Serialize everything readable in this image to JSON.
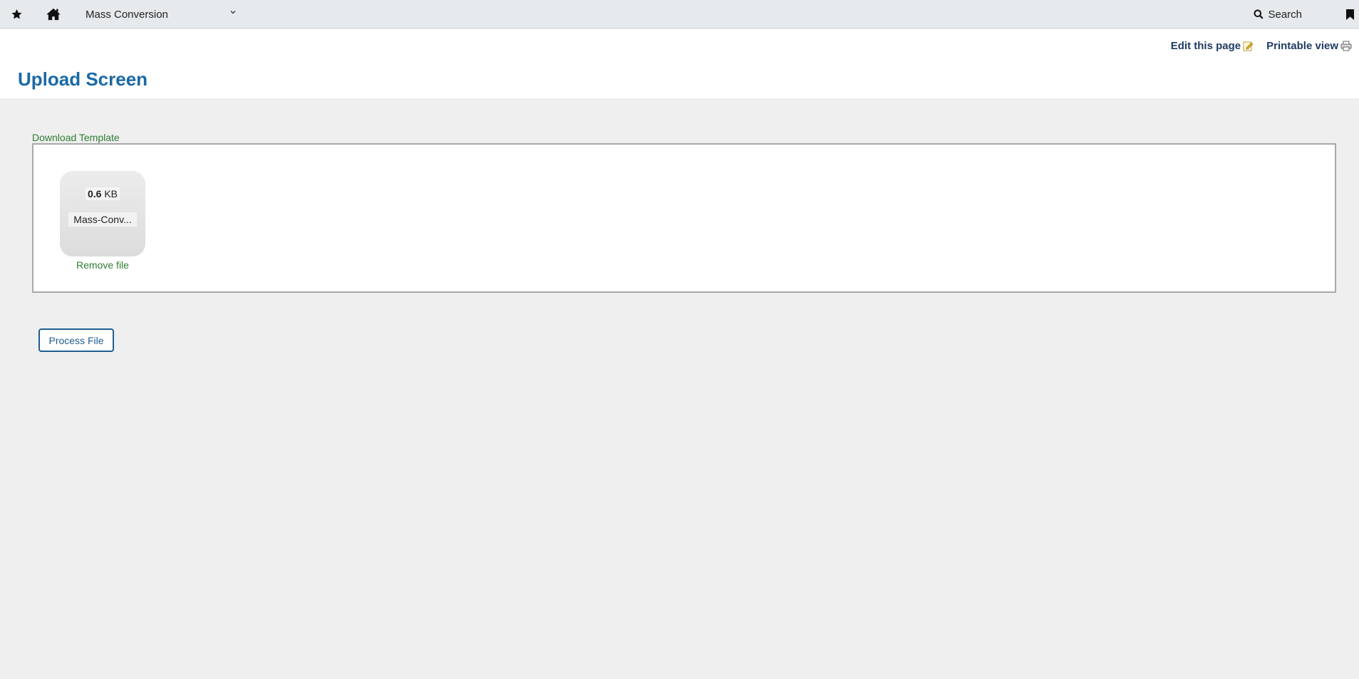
{
  "topbar": {
    "module_label": "Mass Conversion",
    "search_label": "Search",
    "icons": [
      "star-icon",
      "home-icon",
      "chevron-down-icon",
      "search-icon",
      "bookmark-icon"
    ]
  },
  "header": {
    "edit_label": "Edit this page",
    "printable_label": "Printable view",
    "title": "Upload Screen"
  },
  "upload": {
    "download_label": "Download Template",
    "file": {
      "size_value": "0.6",
      "size_unit": "KB",
      "name": "Mass-Conv..."
    },
    "remove_label": "Remove file"
  },
  "actions": {
    "process_label": "Process File"
  },
  "colors": {
    "topbar_bg": "#e6eaed",
    "title": "#1a69a6",
    "link_green": "#2e7d32",
    "button_border": "#1f5e92",
    "page_bg": "#efefef"
  }
}
